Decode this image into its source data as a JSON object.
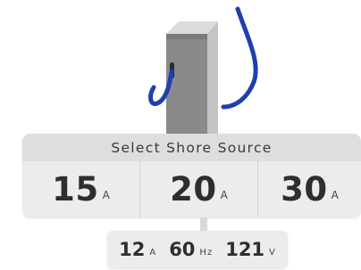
{
  "selector": {
    "title": "Select Shore Source",
    "options": [
      {
        "value": "15",
        "unit": "A"
      },
      {
        "value": "20",
        "unit": "A"
      },
      {
        "value": "30",
        "unit": "A"
      }
    ]
  },
  "readout": {
    "current": {
      "value": "12",
      "unit": "A"
    },
    "frequency": {
      "value": "60",
      "unit": "Hz"
    },
    "voltage": {
      "value": "121",
      "unit": "V"
    }
  },
  "colors": {
    "cable": "#1e3fb0",
    "pedestal_front": "#8a8a8a",
    "pedestal_side": "#c4c4c4",
    "panel_bg": "#ececec",
    "header_bg": "#dedede"
  },
  "icons": {
    "pedestal": "shore-power-pedestal-icon",
    "cable": "power-cable-icon"
  }
}
